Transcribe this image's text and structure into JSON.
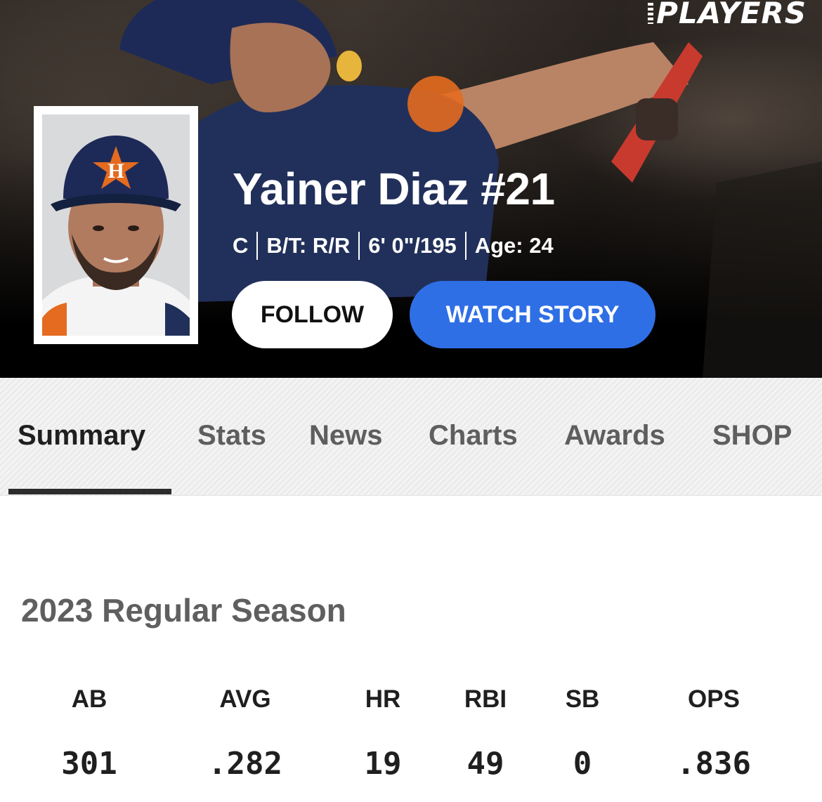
{
  "brand": {
    "logo_text": "PLAYERS"
  },
  "player": {
    "name": "Yainer Diaz #21",
    "position": "C",
    "bats_throws": "B/T: R/R",
    "height_weight": "6' 0\"/195",
    "age": "Age: 24"
  },
  "actions": {
    "follow_label": "FOLLOW",
    "watch_story_label": "WATCH STORY"
  },
  "tabs": [
    {
      "label": "Summary",
      "active": true
    },
    {
      "label": "Stats"
    },
    {
      "label": "News"
    },
    {
      "label": "Charts"
    },
    {
      "label": "Awards"
    },
    {
      "label": "SHOP"
    }
  ],
  "season": {
    "title": "2023 Regular Season",
    "headers": [
      "AB",
      "AVG",
      "HR",
      "RBI",
      "SB",
      "OPS"
    ],
    "values": [
      "301",
      ".282",
      "19",
      "49",
      "0",
      ".836"
    ]
  },
  "colors": {
    "watch_button": "#2f6fe6",
    "follow_button": "#ffffff",
    "tab_active": "#1f1f1f",
    "tab_inactive": "#5e5e5e"
  }
}
